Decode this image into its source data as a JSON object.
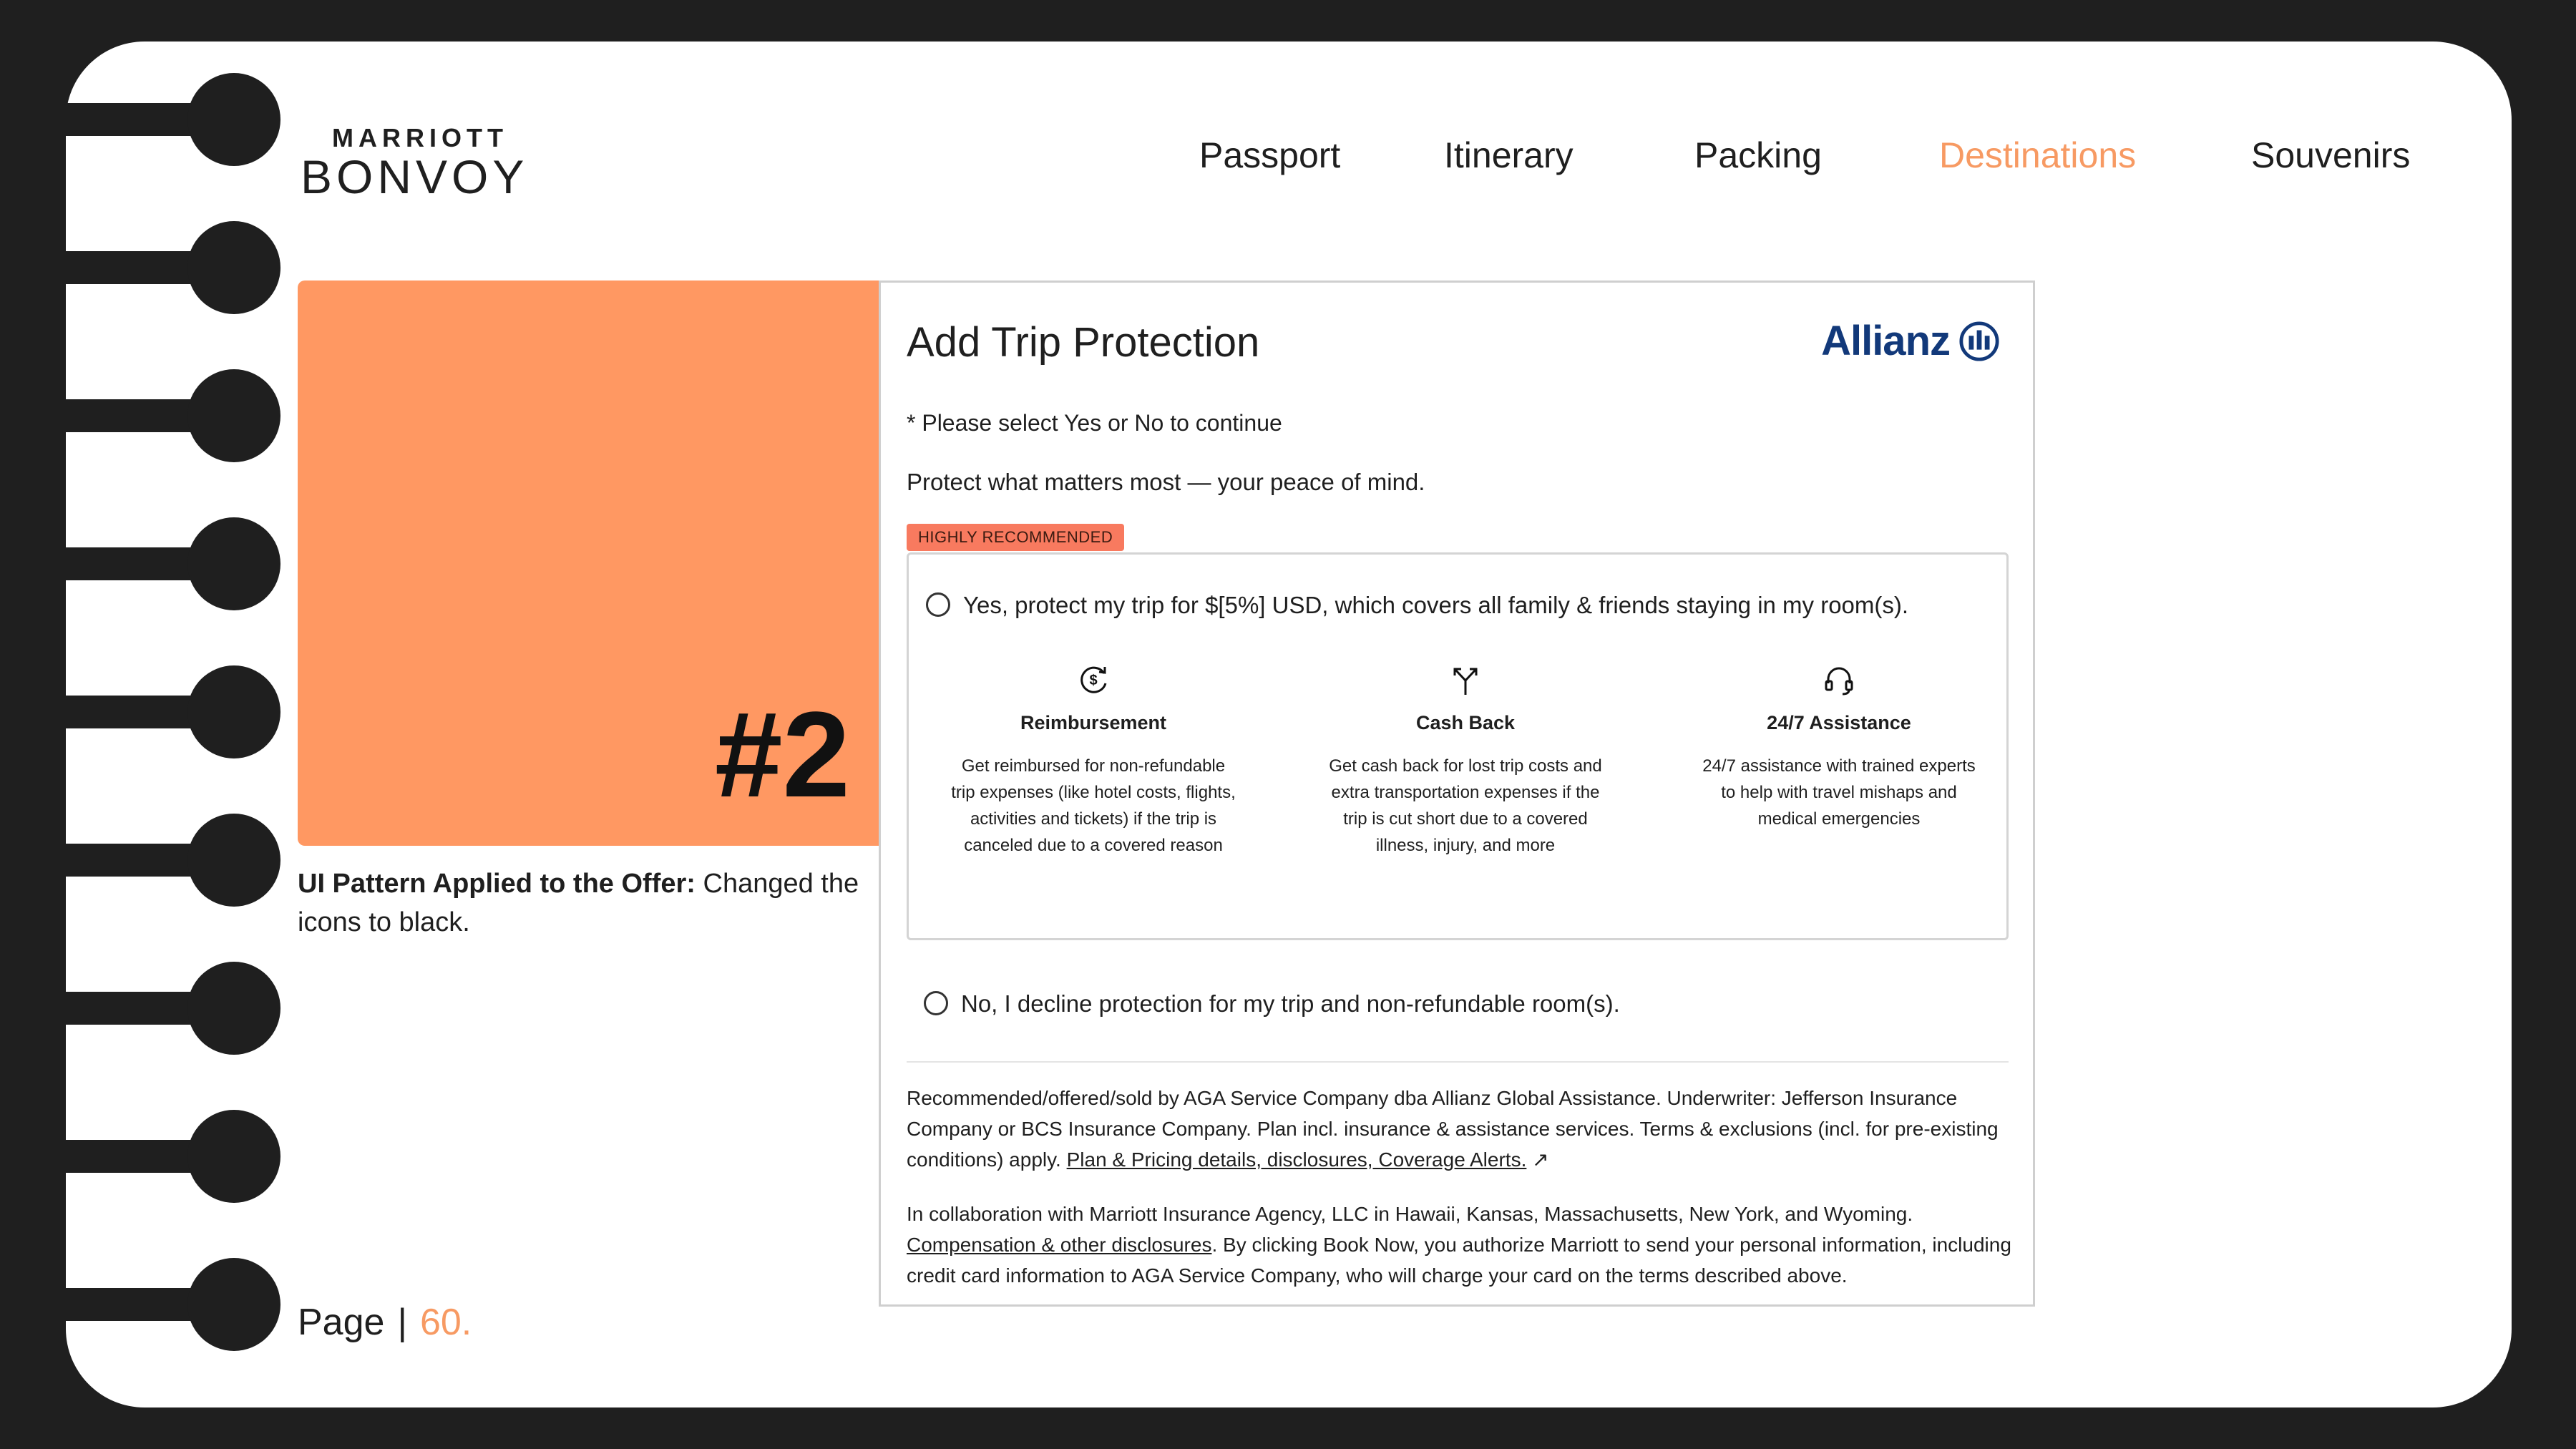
{
  "header": {
    "logo_top": "MARRIOTT",
    "logo_bottom": "BONVOY",
    "nav": [
      "Passport",
      "Itinerary",
      "Packing",
      "Destinations",
      "Souvenirs"
    ],
    "active_nav": "Destinations"
  },
  "panel": {
    "number": "#2",
    "caption_bold": "UI Pattern Applied to the Offer:",
    "caption_rest": " Changed the icons to black."
  },
  "page": {
    "label": "Page",
    "separator": "|",
    "number": "60."
  },
  "offer": {
    "title": "Add Trip Protection",
    "brand": "Allianz",
    "note": "* Please select Yes or No to continue",
    "tagline": "Protect what matters most — your peace of mind.",
    "badge": "HIGHLY RECOMMENDED",
    "yes_label": "Yes, protect my trip for $[5%] USD, which covers all family & friends staying in my room(s).",
    "benefits": [
      {
        "icon": "refund-dollar-icon",
        "title": "Reimbursement",
        "desc": "Get reimbursed for non-refundable trip expenses (like hotel costs, flights, activities and tickets) if the trip is canceled due to a covered reason"
      },
      {
        "icon": "split-arrow-icon",
        "title": "Cash Back",
        "desc": "Get cash back for lost trip costs and extra transportation expenses if the trip is cut short due to a covered illness, injury, and more"
      },
      {
        "icon": "headset-icon",
        "title": "24/7 Assistance",
        "desc": "24/7 assistance with trained experts to help with travel mishaps and medical emergencies"
      }
    ],
    "no_label": "No, I decline protection for my trip and non-refundable room(s).",
    "legal1_text": "Recommended/offered/sold by AGA Service Company dba Allianz Global Assistance. Underwriter: Jefferson Insurance Company or BCS Insurance Company. Plan incl. insurance & assistance services. Terms & exclusions (incl. for pre-existing conditions) apply. ",
    "legal1_link": "Plan & Pricing details, disclosures, Coverage Alerts.",
    "legal2_text_a": "In collaboration with Marriott Insurance Agency, LLC in Hawaii, Kansas, Massachusetts, New York, and Wyoming. ",
    "legal2_link": "Compensation & other disclosures",
    "legal2_text_b": ". By clicking Book Now, you authorize Marriott to send your personal information, including credit card information to AGA Service Company, who will charge your card on the terms described above."
  },
  "colors": {
    "accent": "#ff9862",
    "nav_active": "#f79a63",
    "badge": "#f87a5f",
    "allianz_blue": "#12397a",
    "frame": "#1f1f1f"
  }
}
